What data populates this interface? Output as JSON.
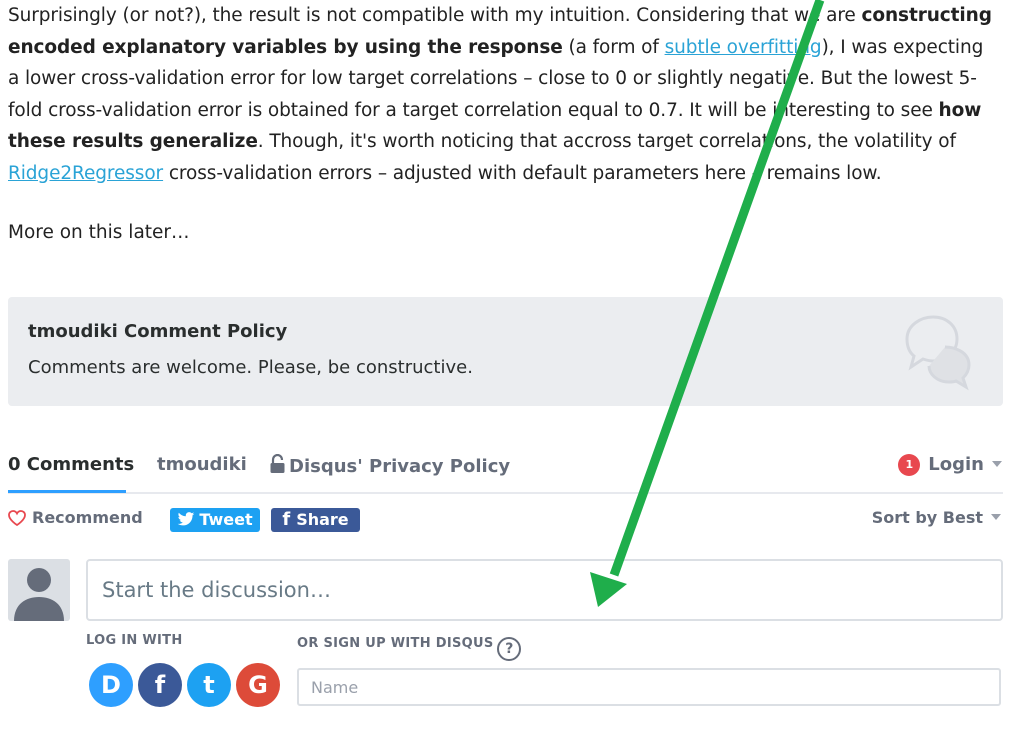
{
  "article": {
    "p1": {
      "t1": "Surprisingly (or not?), the result is not compatible with my intuition. Considering that we are ",
      "b1": "constructing encoded explanatory variables by using the response",
      "t2": " (a form of ",
      "link1": "subtle overfitting",
      "t3": "), I was expecting a lower cross-validation error for low target correlations – close to 0 or slightly negative. But the lowest 5-fold cross-validation error is obtained for a target correlation equal to 0.7. It will be interesting to see ",
      "b2": "how these results generalize",
      "t4": ". Though, it's worth noticing that accross target correlations, the volatility of ",
      "link2": "Ridge2Regressor",
      "t5": " cross-validation errors – adjusted with default parameters here – remains low."
    },
    "more": "More on this later…"
  },
  "policy": {
    "title": "tmoudiki Comment Policy",
    "text": "Comments are welcome. Please, be constructive.",
    "icon": "chat-bubbles-icon"
  },
  "tabs": {
    "comments": "0 Comments",
    "community": "tmoudiki",
    "privacy": "Disqus' Privacy Policy",
    "login_badge": "1",
    "login": "Login"
  },
  "actions": {
    "recommend": "Recommend",
    "tweet": "Tweet",
    "share": "Share",
    "sort": "Sort by Best"
  },
  "composer": {
    "placeholder": "Start the discussion…"
  },
  "signin": {
    "login_with": "LOG IN WITH",
    "signup": "OR SIGN UP WITH DISQUS",
    "help": "?",
    "name_placeholder": "Name",
    "providers": [
      {
        "name": "D",
        "color": "#2e9fff"
      },
      {
        "name": "f",
        "color": "#3b5998"
      },
      {
        "name": "t",
        "color": "#1da1f2"
      },
      {
        "name": "G",
        "color": "#dd4b39"
      }
    ]
  },
  "annotation": {
    "arrow_color": "#1fae4b"
  }
}
